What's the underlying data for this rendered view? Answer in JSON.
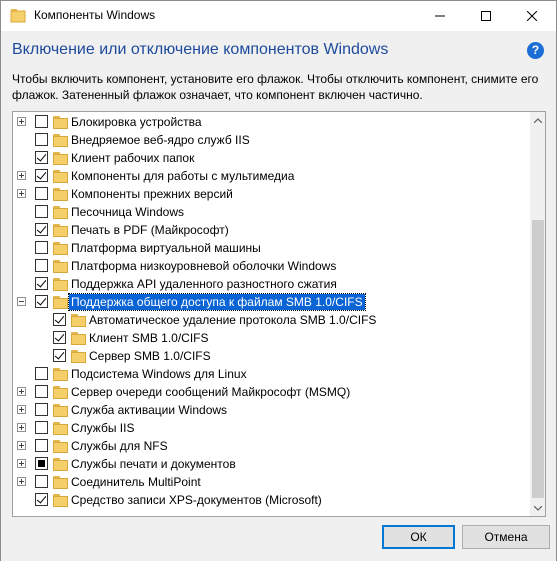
{
  "window": {
    "title": "Компоненты Windows",
    "heading": "Включение или отключение компонентов Windows",
    "description": "Чтобы включить компонент, установите его флажок. Чтобы отключить компонент, снимите его флажок. Затененный флажок означает, что компонент включен частично.",
    "help_icon": "question-icon",
    "help_label": "?"
  },
  "features": [
    {
      "label": "Блокировка устройства",
      "expander": "plus",
      "check": "unchecked",
      "level": 0
    },
    {
      "label": "Внедряемое веб-ядро служб IIS",
      "expander": "none",
      "check": "unchecked",
      "level": 0
    },
    {
      "label": "Клиент рабочих папок",
      "expander": "none",
      "check": "checked",
      "level": 0
    },
    {
      "label": "Компоненты для работы с мультимедиа",
      "expander": "plus",
      "check": "checked",
      "level": 0
    },
    {
      "label": "Компоненты прежних версий",
      "expander": "plus",
      "check": "unchecked",
      "level": 0
    },
    {
      "label": "Песочница Windows",
      "expander": "none",
      "check": "unchecked",
      "level": 0
    },
    {
      "label": "Печать в PDF (Майкрософт)",
      "expander": "none",
      "check": "checked",
      "level": 0
    },
    {
      "label": "Платформа виртуальной машины",
      "expander": "none",
      "check": "unchecked",
      "level": 0
    },
    {
      "label": "Платформа низкоуровневой оболочки Windows",
      "expander": "none",
      "check": "unchecked",
      "level": 0
    },
    {
      "label": "Поддержка API удаленного разностного сжатия",
      "expander": "none",
      "check": "checked",
      "level": 0
    },
    {
      "label": "Поддержка общего доступа к файлам SMB 1.0/CIFS",
      "expander": "minus",
      "check": "checked",
      "level": 0,
      "selected": true
    },
    {
      "label": "Автоматическое удаление протокола SMB 1.0/CIFS",
      "expander": "none",
      "check": "checked",
      "level": 1
    },
    {
      "label": "Клиент SMB 1.0/CIFS",
      "expander": "none",
      "check": "checked",
      "level": 1
    },
    {
      "label": "Сервер SMB 1.0/CIFS",
      "expander": "none",
      "check": "checked",
      "level": 1
    },
    {
      "label": "Подсистема Windows для Linux",
      "expander": "none",
      "check": "unchecked",
      "level": 0
    },
    {
      "label": "Сервер очереди сообщений Майкрософт (MSMQ)",
      "expander": "plus",
      "check": "unchecked",
      "level": 0
    },
    {
      "label": "Служба активации Windows",
      "expander": "plus",
      "check": "unchecked",
      "level": 0
    },
    {
      "label": "Службы IIS",
      "expander": "plus",
      "check": "unchecked",
      "level": 0
    },
    {
      "label": "Службы для NFS",
      "expander": "plus",
      "check": "unchecked",
      "level": 0
    },
    {
      "label": "Службы печати и документов",
      "expander": "plus",
      "check": "partial",
      "level": 0
    },
    {
      "label": "Соединитель MultiPoint",
      "expander": "plus",
      "check": "unchecked",
      "level": 0
    },
    {
      "label": "Средство записи XPS-документов (Microsoft)",
      "expander": "none",
      "check": "checked",
      "level": 0
    }
  ],
  "buttons": {
    "ok": "ОК",
    "cancel": "Отмена"
  },
  "colors": {
    "heading": "#1d4a9c",
    "selection": "#0a64d6",
    "folder": "#f5cf6a"
  }
}
